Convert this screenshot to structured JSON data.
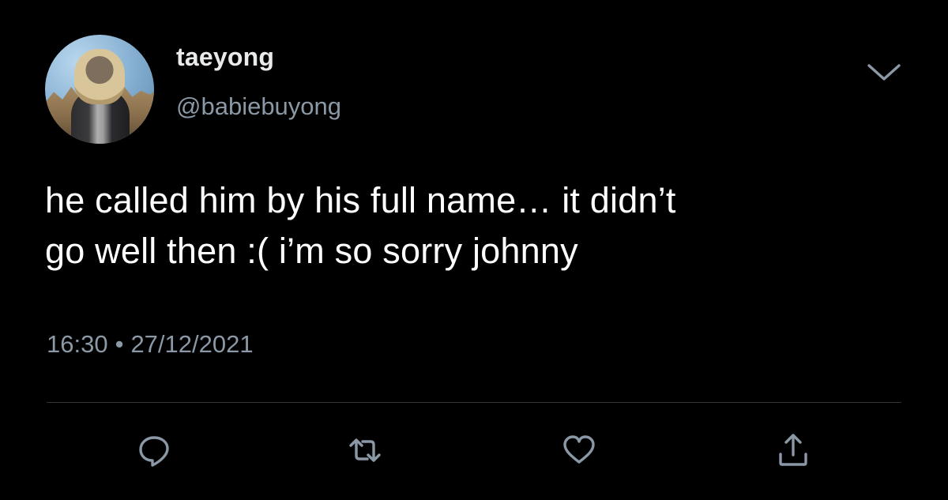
{
  "tweet": {
    "author": {
      "name": "taeyong",
      "handle": "@babiebuyong",
      "avatar_icon": "profile-photo"
    },
    "text_lines": [
      "he called him by his full name… it didn’t",
      "go well then :( i’m so sorry johnny"
    ],
    "time": "16:30",
    "separator": "•",
    "date": "27/12/2021"
  },
  "actions": {
    "reply_icon": "reply-bubble-icon",
    "retweet_icon": "retweet-arrows-icon",
    "like_icon": "heart-icon",
    "share_icon": "share-upload-icon",
    "menu_icon": "chevron-down-icon"
  },
  "colors": {
    "background": "#000000",
    "text_primary": "#ffffff",
    "text_secondary": "#8b98a5",
    "divider": "#2f3336",
    "icon": "#8b98a5"
  }
}
